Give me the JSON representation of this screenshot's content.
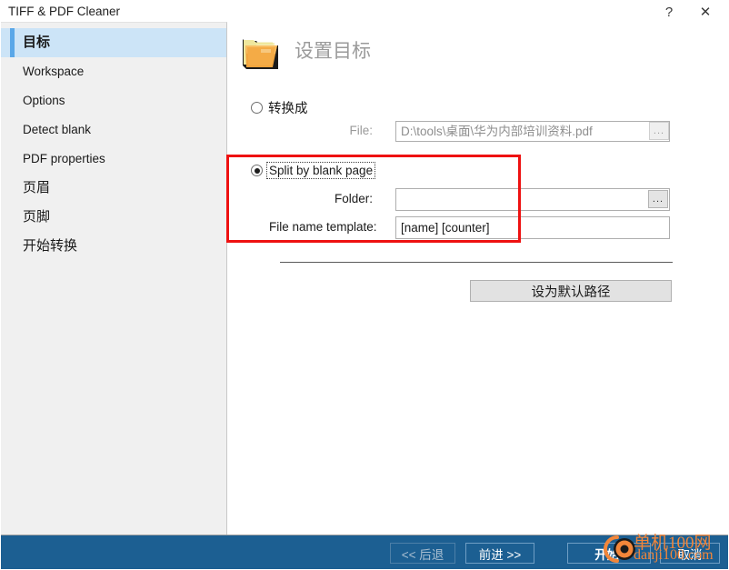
{
  "window": {
    "title": "TIFF & PDF Cleaner",
    "help_icon": "question-mark-icon",
    "close_icon": "close-icon"
  },
  "sidebar": {
    "items": [
      {
        "label": "目标",
        "selected": true
      },
      {
        "label": "Workspace",
        "selected": false
      },
      {
        "label": "Options",
        "selected": false
      },
      {
        "label": "Detect blank",
        "selected": false
      },
      {
        "label": "PDF properties",
        "selected": false
      },
      {
        "label": "页眉",
        "selected": false
      },
      {
        "label": "页脚",
        "selected": false
      },
      {
        "label": "开始转换",
        "selected": false
      }
    ]
  },
  "main": {
    "page_title": "设置目标",
    "folder_icon": "folder-icon",
    "convert_to": {
      "radio_label": "转换成",
      "selected": false,
      "file_label": "File:",
      "file_value": "D:\\tools\\桌面\\华为内部培训资料.pdf",
      "browse_label": "..."
    },
    "split_by_blank": {
      "radio_label": "Split by blank page",
      "selected": true,
      "folder_label": "Folder:",
      "folder_value": "",
      "folder_browse_label": "...",
      "template_label": "File name template:",
      "template_value": "[name] [counter]"
    },
    "default_path_button": "设为默认路径"
  },
  "footer": {
    "back_label": "<< 后退",
    "back_disabled": true,
    "next_label": "前进 >>",
    "start_label": "开始!",
    "cancel_label": "取消"
  },
  "watermark": {
    "line1": "单机100网",
    "line2": "danji100.com",
    "logo": "circle-logo-icon"
  },
  "colors": {
    "footer_blue": "#1c5f92",
    "selected_item_bg": "#cce4f7",
    "selected_accent": "#5aa7e8",
    "annotation_red": "#ee1111",
    "watermark_orange": "#f2863a"
  }
}
